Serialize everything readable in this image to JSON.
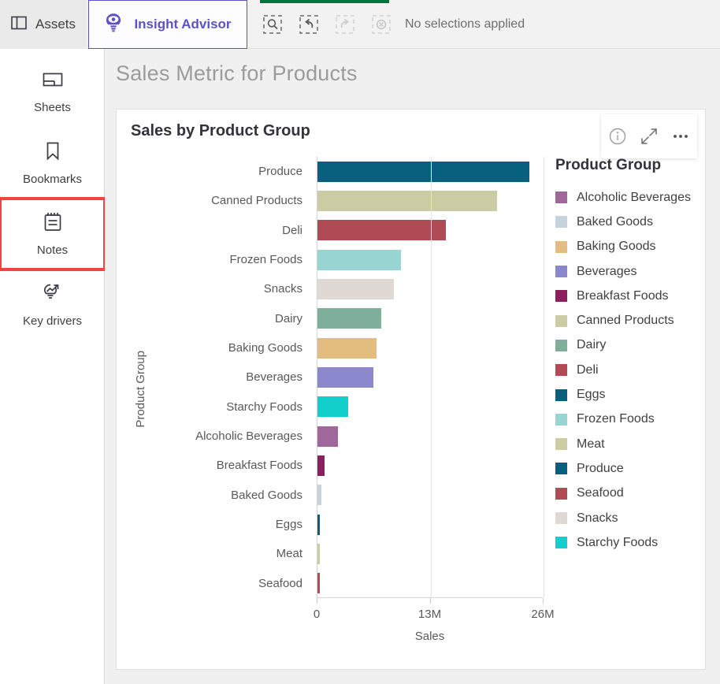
{
  "topbar": {
    "assets_label": "Assets",
    "assets_icon": "panel-layout-icon",
    "insight_advisor_label": "Insight Advisor",
    "insight_advisor_icon": "insight-bulb-eye-icon",
    "insight_advisor_accent": "#5d52c5",
    "selection_tools": [
      {
        "name": "selection-search-icon",
        "enabled": true
      },
      {
        "name": "step-back-icon",
        "enabled": true
      },
      {
        "name": "step-forward-icon",
        "enabled": false
      },
      {
        "name": "clear-all-selections-icon",
        "enabled": false
      }
    ],
    "no_selections_text": "No selections applied",
    "progress_strip_color": "#00743e"
  },
  "sidebar": {
    "items": [
      {
        "label": "Sheets",
        "icon": "sheets-icon",
        "highlighted": false
      },
      {
        "label": "Bookmarks",
        "icon": "bookmark-icon",
        "highlighted": false
      },
      {
        "label": "Notes",
        "icon": "notes-icon",
        "highlighted": true
      },
      {
        "label": "Key drivers",
        "icon": "key-drivers-trend-icon",
        "highlighted": false
      }
    ],
    "highlight_color": "#f2443c"
  },
  "main": {
    "page_title": "Sales Metric for Products",
    "card": {
      "title": "Sales by Product Group",
      "tools": [
        {
          "name": "info-icon",
          "glyph": "i"
        },
        {
          "name": "fullscreen-expand-icon",
          "glyph": "expand"
        },
        {
          "name": "more-options-icon",
          "glyph": "..."
        }
      ]
    }
  },
  "chart_data": {
    "type": "bar",
    "orientation": "horizontal",
    "title": "Sales by Product Group",
    "xlabel": "Sales",
    "ylabel": "Product Group",
    "xlim": [
      0,
      26000000
    ],
    "xticks": [
      0,
      13000000,
      26000000
    ],
    "xtick_labels": [
      "0",
      "13M",
      "26M"
    ],
    "grid": true,
    "legend_title": "Product Group",
    "legend_position": "right",
    "categories": [
      "Produce",
      "Canned Products",
      "Deli",
      "Frozen Foods",
      "Snacks",
      "Dairy",
      "Baking Goods",
      "Beverages",
      "Starchy Foods",
      "Alcoholic Beverages",
      "Breakfast Foods",
      "Baked Goods",
      "Eggs",
      "Meat",
      "Seafood"
    ],
    "values": [
      24400000,
      20700000,
      14800000,
      9600000,
      8800000,
      7300000,
      6800000,
      6400000,
      3500000,
      2350000,
      780000,
      460000,
      280000,
      90000,
      90000
    ],
    "bar_colors": [
      "#06607e",
      "#cbcba4",
      "#b04a54",
      "#98d4d2",
      "#e0d8d3",
      "#7fae9a",
      "#e3bc80",
      "#8a87cd",
      "#12cfcb",
      "#a0689a",
      "#8d1f5f",
      "#c6d3dd",
      "#0d5e7d",
      "#cbcba4",
      "#b04a54"
    ],
    "legend_entries": [
      {
        "label": "Alcoholic Beverages",
        "color": "#a0689a"
      },
      {
        "label": "Baked Goods",
        "color": "#c6d3dd"
      },
      {
        "label": "Baking Goods",
        "color": "#e3bc80"
      },
      {
        "label": "Beverages",
        "color": "#8a87cd"
      },
      {
        "label": "Breakfast Foods",
        "color": "#8d1f5f"
      },
      {
        "label": "Canned Products",
        "color": "#cbcba4"
      },
      {
        "label": "Dairy",
        "color": "#7fae9a"
      },
      {
        "label": "Deli",
        "color": "#b04a54"
      },
      {
        "label": "Eggs",
        "color": "#0d5e7d"
      },
      {
        "label": "Frozen Foods",
        "color": "#98d4d2"
      },
      {
        "label": "Meat",
        "color": "#cbcba4"
      },
      {
        "label": "Produce",
        "color": "#06607e"
      },
      {
        "label": "Seafood",
        "color": "#b04a54"
      },
      {
        "label": "Snacks",
        "color": "#e0d8d3"
      },
      {
        "label": "Starchy Foods",
        "color": "#12cfcb"
      }
    ]
  }
}
